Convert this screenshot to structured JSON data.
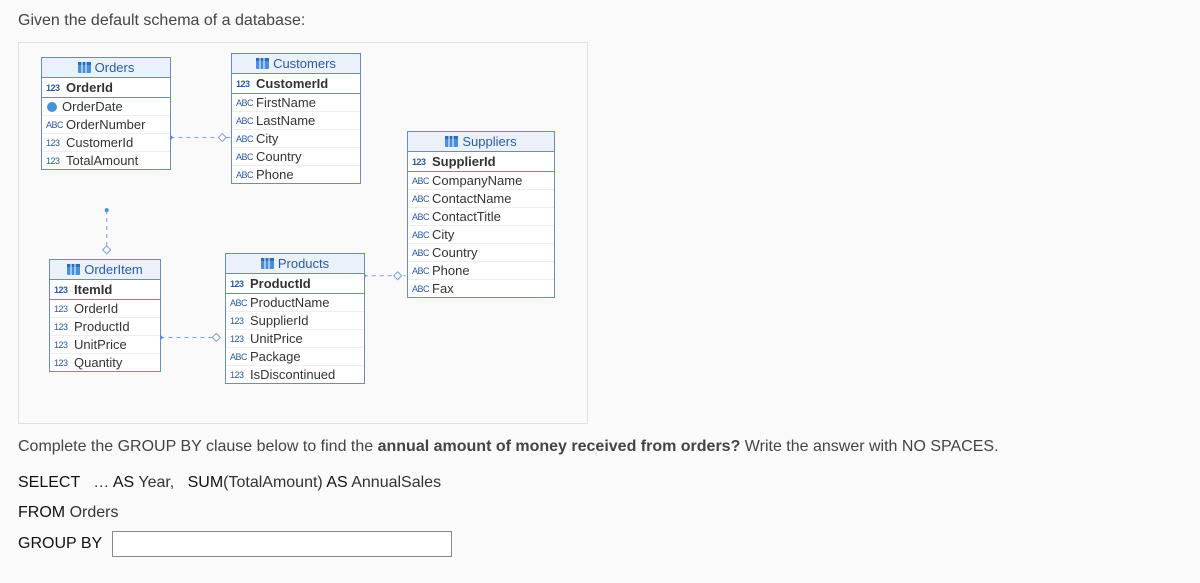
{
  "intro": "Given the default schema of a database:",
  "tables": {
    "orders": {
      "title": "Orders",
      "pk": "OrderId",
      "pk_type": "123",
      "cols": [
        {
          "type": "date",
          "name": "OrderDate"
        },
        {
          "type": "ABC",
          "name": "OrderNumber"
        },
        {
          "type": "123",
          "name": "CustomerId"
        },
        {
          "type": "123",
          "name": "TotalAmount"
        }
      ]
    },
    "customers": {
      "title": "Customers",
      "pk": "CustomerId",
      "pk_type": "123",
      "cols": [
        {
          "type": "ABC",
          "name": "FirstName"
        },
        {
          "type": "ABC",
          "name": "LastName"
        },
        {
          "type": "ABC",
          "name": "City"
        },
        {
          "type": "ABC",
          "name": "Country"
        },
        {
          "type": "ABC",
          "name": "Phone"
        }
      ]
    },
    "suppliers": {
      "title": "Suppliers",
      "pk": "SupplierId",
      "pk_type": "123",
      "cols": [
        {
          "type": "ABC",
          "name": "CompanyName"
        },
        {
          "type": "ABC",
          "name": "ContactName"
        },
        {
          "type": "ABC",
          "name": "ContactTitle"
        },
        {
          "type": "ABC",
          "name": "City"
        },
        {
          "type": "ABC",
          "name": "Country"
        },
        {
          "type": "ABC",
          "name": "Phone"
        },
        {
          "type": "ABC",
          "name": "Fax"
        }
      ]
    },
    "orderitem": {
      "title": "OrderItem",
      "pk": "ItemId",
      "pk_type": "123",
      "cols": [
        {
          "type": "123",
          "name": "OrderId"
        },
        {
          "type": "123",
          "name": "ProductId"
        },
        {
          "type": "123",
          "name": "UnitPrice"
        },
        {
          "type": "123",
          "name": "Quantity"
        }
      ]
    },
    "products": {
      "title": "Products",
      "pk": "ProductId",
      "pk_type": "123",
      "cols": [
        {
          "type": "ABC",
          "name": "ProductName"
        },
        {
          "type": "123",
          "name": "SupplierId"
        },
        {
          "type": "123",
          "name": "UnitPrice"
        },
        {
          "type": "ABC",
          "name": "Package"
        },
        {
          "type": "123",
          "name": "IsDiscontinued"
        }
      ]
    }
  },
  "question_prefix": "Complete the GROUP BY clause below to find the ",
  "question_bold": "annual amount of money received from orders?",
  "question_suffix": " Write the answer with NO SPACES.",
  "sql": {
    "select_kw": "SELECT",
    "ellipsis": "…",
    "as1": "AS",
    "year": "Year,",
    "sum_fn": "SUM",
    "sum_arg": "(TotalAmount)",
    "as2": "AS",
    "alias2": "AnnualSales",
    "from_kw": "FROM",
    "from_tbl": "Orders",
    "groupby_kw": "GROUP BY",
    "input_value": ""
  }
}
